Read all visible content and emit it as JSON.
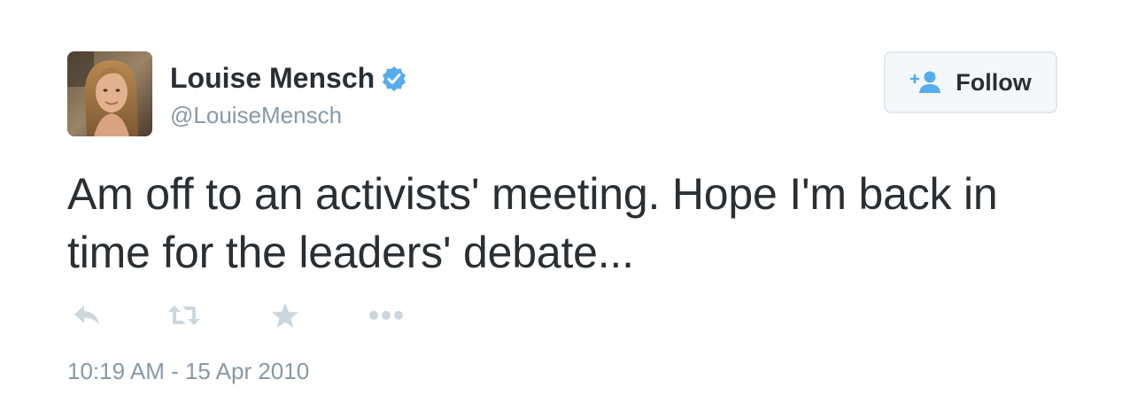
{
  "author": {
    "display_name": "Louise Mensch",
    "handle": "@LouiseMensch",
    "verified_icon": "verified-badge-icon"
  },
  "follow_button": {
    "label": "Follow",
    "icon": "follow-person-plus-icon"
  },
  "tweet": {
    "text": "Am off to an activists' meeting. Hope I'm back in time for the leaders' debate...",
    "timestamp": "10:19 AM - 15 Apr 2010"
  },
  "actions": [
    {
      "name": "reply",
      "icon": "reply-icon"
    },
    {
      "name": "retweet",
      "icon": "retweet-icon"
    },
    {
      "name": "favorite",
      "icon": "star-icon"
    },
    {
      "name": "more",
      "icon": "more-dots-icon"
    }
  ],
  "colors": {
    "text": "#292f33",
    "muted": "#8899a6",
    "verified": "#55acee",
    "action_icon": "#ccd6dd"
  }
}
